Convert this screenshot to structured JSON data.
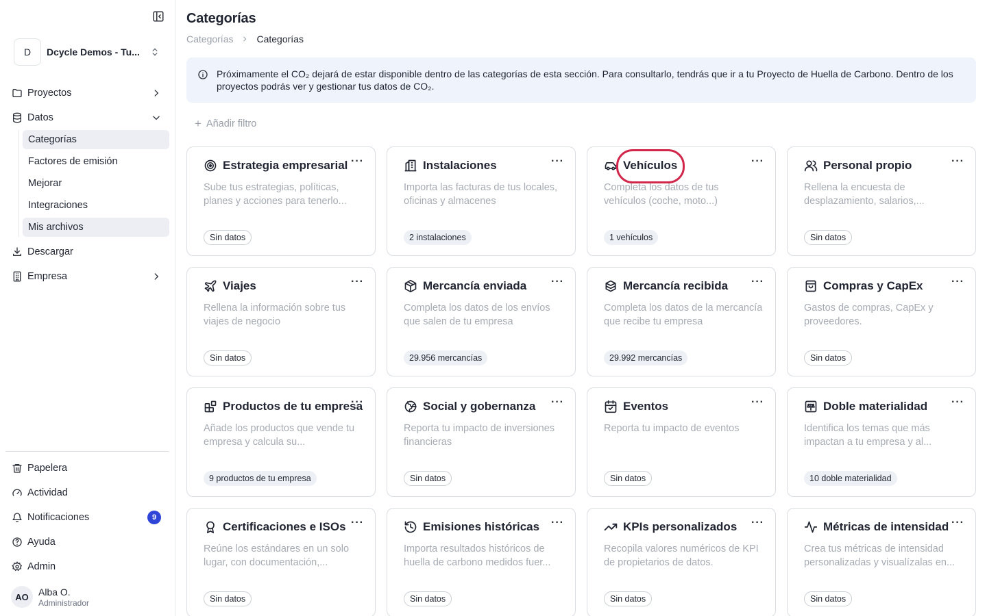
{
  "sidebar": {
    "org": {
      "initial": "D",
      "name": "Dcycle Demos - Tu..."
    },
    "nav": [
      {
        "label": "Proyectos",
        "icon": "folder-icon"
      },
      {
        "label": "Datos",
        "icon": "database-icon"
      }
    ],
    "datos_children": [
      "Categorías",
      "Factores de emisión",
      "Mejorar",
      "Integraciones",
      "Mis archivos"
    ],
    "nav2": [
      {
        "label": "Descargar",
        "icon": "download-icon"
      },
      {
        "label": "Empresa",
        "icon": "building-icon"
      }
    ],
    "bottom": [
      {
        "label": "Papelera",
        "icon": "trash-icon"
      },
      {
        "label": "Actividad",
        "icon": "activity-gauge-icon"
      },
      {
        "label": "Notificaciones",
        "icon": "bell-icon",
        "badge": "9"
      },
      {
        "label": "Ayuda",
        "icon": "help-circle-icon"
      },
      {
        "label": "Admin",
        "icon": "gear-icon"
      }
    ],
    "user": {
      "initials": "AO",
      "name": "Alba O.",
      "role": "Administrador"
    }
  },
  "header": {
    "title": "Categorías",
    "breadcrumb": [
      "Categorías",
      "Categorías"
    ]
  },
  "info_banner": {
    "text": "Próximamente el CO₂ dejará de estar disponible dentro de las categorías de esta sección. Para consultarlo, tendrás que ir a tu Proyecto de Huella de Carbono. Dentro de los proyectos podrás ver y gestionar tus datos de CO₂."
  },
  "filter": {
    "label": "Añadir filtro"
  },
  "menu_glyph": "···",
  "cards": [
    {
      "title": "Estrategia empresarial",
      "icon": "target-icon",
      "desc": "Sube tus estrategias, políticas, planes y acciones para tenerlo...",
      "badge": "Sin datos",
      "has_data": false
    },
    {
      "title": "Instalaciones",
      "icon": "building-icon",
      "desc": "Importa las facturas de tus locales, oficinas y almacenes",
      "badge": "2 instalaciones",
      "has_data": true
    },
    {
      "title": "Vehículos",
      "icon": "car-icon",
      "desc": "Completa los datos de tus vehículos (coche, moto...)",
      "badge": "1 vehículos",
      "has_data": true
    },
    {
      "title": "Personal propio",
      "icon": "users-icon",
      "desc": "Rellena la encuesta de desplazamiento, salarios,...",
      "badge": "Sin datos",
      "has_data": false
    },
    {
      "title": "Viajes",
      "icon": "plane-icon",
      "desc": "Rellena la información sobre tus viajes de negocio",
      "badge": "Sin datos",
      "has_data": false
    },
    {
      "title": "Mercancía enviada",
      "icon": "package-icon",
      "desc": "Completa los datos de los envíos que salen de tu empresa",
      "badge": "29.956 mercancías",
      "has_data": true
    },
    {
      "title": "Mercancía recibida",
      "icon": "boxes-icon",
      "desc": "Completa los datos de la mercancía que recibe tu empresa",
      "badge": "29.992 mercancías",
      "has_data": true
    },
    {
      "title": "Compras y CapEx",
      "icon": "shopping-bag-icon",
      "desc": "Gastos de compras, CapEx y proveedores.",
      "badge": "Sin datos",
      "has_data": false
    },
    {
      "title": "Productos de tu empresa",
      "icon": "blocks-icon",
      "desc": "Añade los productos que vende tu empresa y calcula su...",
      "badge": "9 productos de tu empresa",
      "has_data": true
    },
    {
      "title": "Social y gobernanza",
      "icon": "globe-icon",
      "desc": "Reporta tu impacto de inversiones financieras",
      "badge": "Sin datos",
      "has_data": false
    },
    {
      "title": "Eventos",
      "icon": "calendar-icon",
      "desc": "Reporta tu impacto de eventos",
      "badge": "Sin datos",
      "has_data": false
    },
    {
      "title": "Doble materialidad",
      "icon": "scale-icon",
      "desc": "Identifica los temas que más impactan a tu empresa y al...",
      "badge": "10 doble materialidad",
      "has_data": true
    },
    {
      "title": "Certificaciones e ISOs",
      "icon": "award-icon",
      "desc": "Reúne los estándares en un solo lugar, con documentación,...",
      "badge": "Sin datos",
      "has_data": false
    },
    {
      "title": "Emisiones históricas",
      "icon": "history-icon",
      "desc": "Importa resultados históricos de huella de carbono medidos fuer...",
      "badge": "Sin datos",
      "has_data": false
    },
    {
      "title": "KPIs personalizados",
      "icon": "trending-up-icon",
      "desc": "Recopila valores numéricos de KPI de propietarios de datos.",
      "badge": "Sin datos",
      "has_data": false
    },
    {
      "title": "Métricas de intensidad",
      "icon": "pulse-icon",
      "desc": "Crea tus métricas de intensidad personalizadas y visualízalas en...",
      "badge": "Sin datos",
      "has_data": false
    }
  ]
}
